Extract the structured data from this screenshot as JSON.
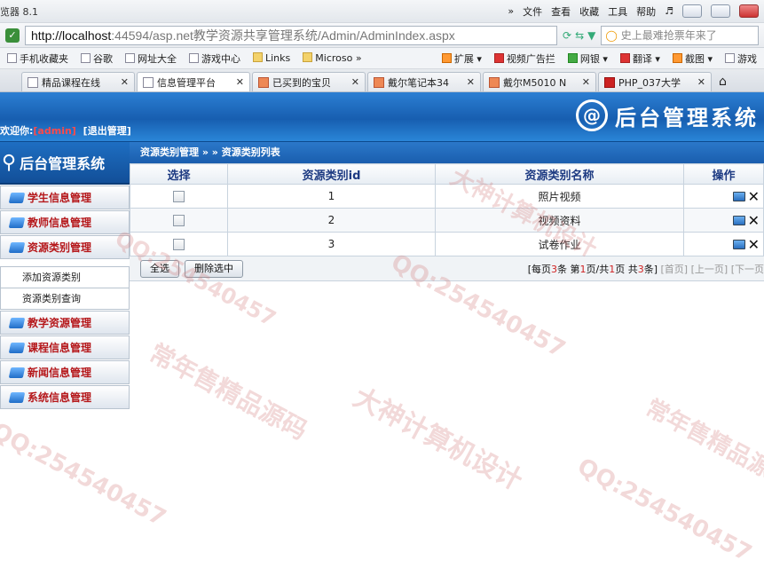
{
  "browser": {
    "app_title": "览器 8.1",
    "menus": [
      "»",
      "文件",
      "查看",
      "收藏",
      "工具",
      "帮助"
    ],
    "url_host": "http://localhost",
    "url_rest": ":44594/asp.net教学资源共享管理系统/Admin/AdminIndex.aspx",
    "search_placeholder": "史上最难抢票年来了",
    "favorites": [
      "手机收藏夹",
      "谷歌",
      "网址大全",
      "游戏中心",
      "Links",
      "Microso »"
    ],
    "favorites_right": [
      "扩展",
      "视频广告拦",
      "网银",
      "翻译",
      "截图",
      "游戏"
    ],
    "tabs": [
      {
        "label": "精品课程在线"
      },
      {
        "label": "信息管理平台"
      },
      {
        "label": "已买到的宝贝"
      },
      {
        "label": "戴尔笔记本34"
      },
      {
        "label": "戴尔M5010 N"
      },
      {
        "label": "PHP_037大学"
      }
    ]
  },
  "header": {
    "welcome_prefix": "欢迎你:",
    "user": "[admin]",
    "logout": "[退出管理]",
    "logo_mark": "@",
    "logo_text": "后台管理系统"
  },
  "sidebar": {
    "title": "后台管理系统",
    "items_top": [
      "学生信息管理",
      "教师信息管理",
      "资源类别管理"
    ],
    "sub_items": [
      "添加资源类别",
      "资源类别查询"
    ],
    "items_bottom": [
      "教学资源管理",
      "课程信息管理",
      "新闻信息管理",
      "系统信息管理"
    ]
  },
  "main": {
    "breadcrumb": "资源类别管理 » » 资源类别列表",
    "columns": [
      "选择",
      "资源类别id",
      "资源类别名称",
      "操作"
    ],
    "rows": [
      {
        "id": "1",
        "name": "照片视频"
      },
      {
        "id": "2",
        "name": "视频资料"
      },
      {
        "id": "3",
        "name": "试卷作业"
      }
    ],
    "select_all": "全选",
    "delete_selected": "删除选中",
    "pager": {
      "p1": "[每页",
      "per_page": "3",
      "p2": "条 第",
      "current": "1",
      "p3": "页/共",
      "total_pages": "1",
      "p4": "页 共",
      "total": "3",
      "p5": "条]",
      "first": "[首页]",
      "prev": "[上一页]",
      "next": "[下一页"
    }
  },
  "watermarks": [
    "QQ:254540457",
    "大神计算机设计",
    "常年售精品源码"
  ]
}
